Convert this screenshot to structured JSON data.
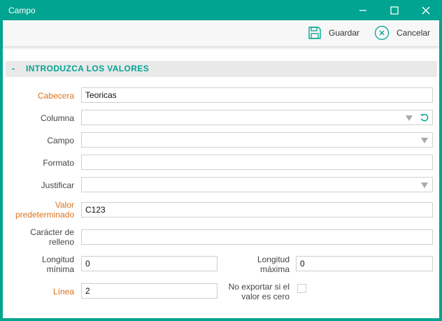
{
  "window": {
    "title": "Campo",
    "accent_color": "#01a491",
    "controls": [
      "minimize-icon",
      "maximize-icon",
      "close-icon"
    ]
  },
  "toolbar": {
    "save_label": "Guardar",
    "save_icon": "save-icon",
    "cancel_label": "Cancelar",
    "cancel_icon": "cancel-icon"
  },
  "section": {
    "toggle": "-",
    "title": "INTRODUZCA LOS VALORES"
  },
  "fields": {
    "cabecera": {
      "label": "Cabecera",
      "value": "Teoricas",
      "required_color": "#d9711c"
    },
    "columna": {
      "label": "Columna",
      "value": "",
      "refresh_icon": "refresh-icon"
    },
    "campo": {
      "label": "Campo",
      "value": ""
    },
    "formato": {
      "label": "Formato",
      "value": ""
    },
    "justificar": {
      "label": "Justificar",
      "value": ""
    },
    "valor_predeterminado": {
      "label_line1": "Valor",
      "label_line2": "predeterminado",
      "value": "C123"
    },
    "caracter_relleno": {
      "label_line1": "Carácter de",
      "label_line2": "relleno",
      "value": ""
    },
    "longitud_minima": {
      "label_line1": "Longitud",
      "label_line2": "mínima",
      "value": "0"
    },
    "longitud_maxima": {
      "label_line1": "Longitud",
      "label_line2": "máxima",
      "value": "0"
    },
    "linea": {
      "label": "Línea",
      "value": "2"
    },
    "no_exportar": {
      "label_line1": "No exportar si el",
      "label_line2": "valor es cero",
      "checked": false
    }
  }
}
